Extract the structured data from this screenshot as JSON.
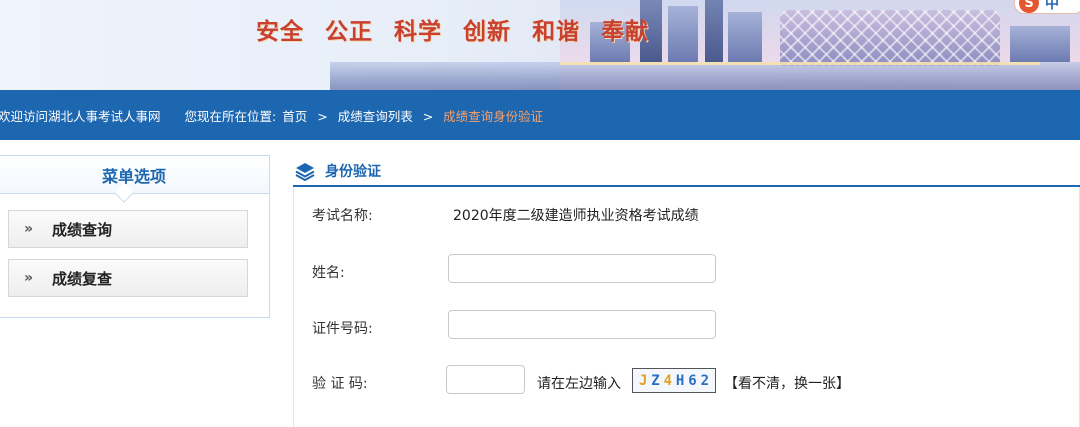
{
  "banner": {
    "slogan": [
      "安全",
      "公正",
      "科学",
      "创新",
      "和谐",
      "奉献"
    ],
    "lang_badge": {
      "icon_letter": "S",
      "text": "中"
    }
  },
  "nav": {
    "welcome": "欢迎访问湖北人事考试人事网",
    "location_label": "您现在所在位置:",
    "breadcrumb": [
      {
        "label": "首页"
      },
      {
        "label": "成绩查询列表"
      },
      {
        "label": "成绩查询身份验证"
      }
    ],
    "separator": ">"
  },
  "menu": {
    "title": "菜单选项",
    "arrow": "»",
    "items": [
      {
        "label": "成绩查询"
      },
      {
        "label": "成绩复查"
      }
    ]
  },
  "panel": {
    "title": "身份验证",
    "exam_name_label": "考试名称:",
    "exam_name_value": "2020年度二级建造师执业资格考试成绩",
    "name_label": "姓名:",
    "name_value": "",
    "id_label": "证件号码:",
    "id_value": "",
    "captcha_label": "验 证 码:",
    "captcha_value": "",
    "captcha_hint": "请在左边输入",
    "captcha_chars": [
      "J",
      "Z",
      "4",
      "H",
      "6",
      "2"
    ],
    "captcha_refresh": "【看不清，换一张】"
  },
  "colors": {
    "nav_bg": "#1d66b0",
    "current_crumb": "#f6a06a",
    "accent_blue": "#1d66b0",
    "slogan_red": "#c8402f",
    "captcha_char_colors": [
      "#e0a22a",
      "#2b6fc2",
      "#e0a22a",
      "#2b6fc2",
      "#2b6fc2",
      "#2b6fc2"
    ]
  }
}
